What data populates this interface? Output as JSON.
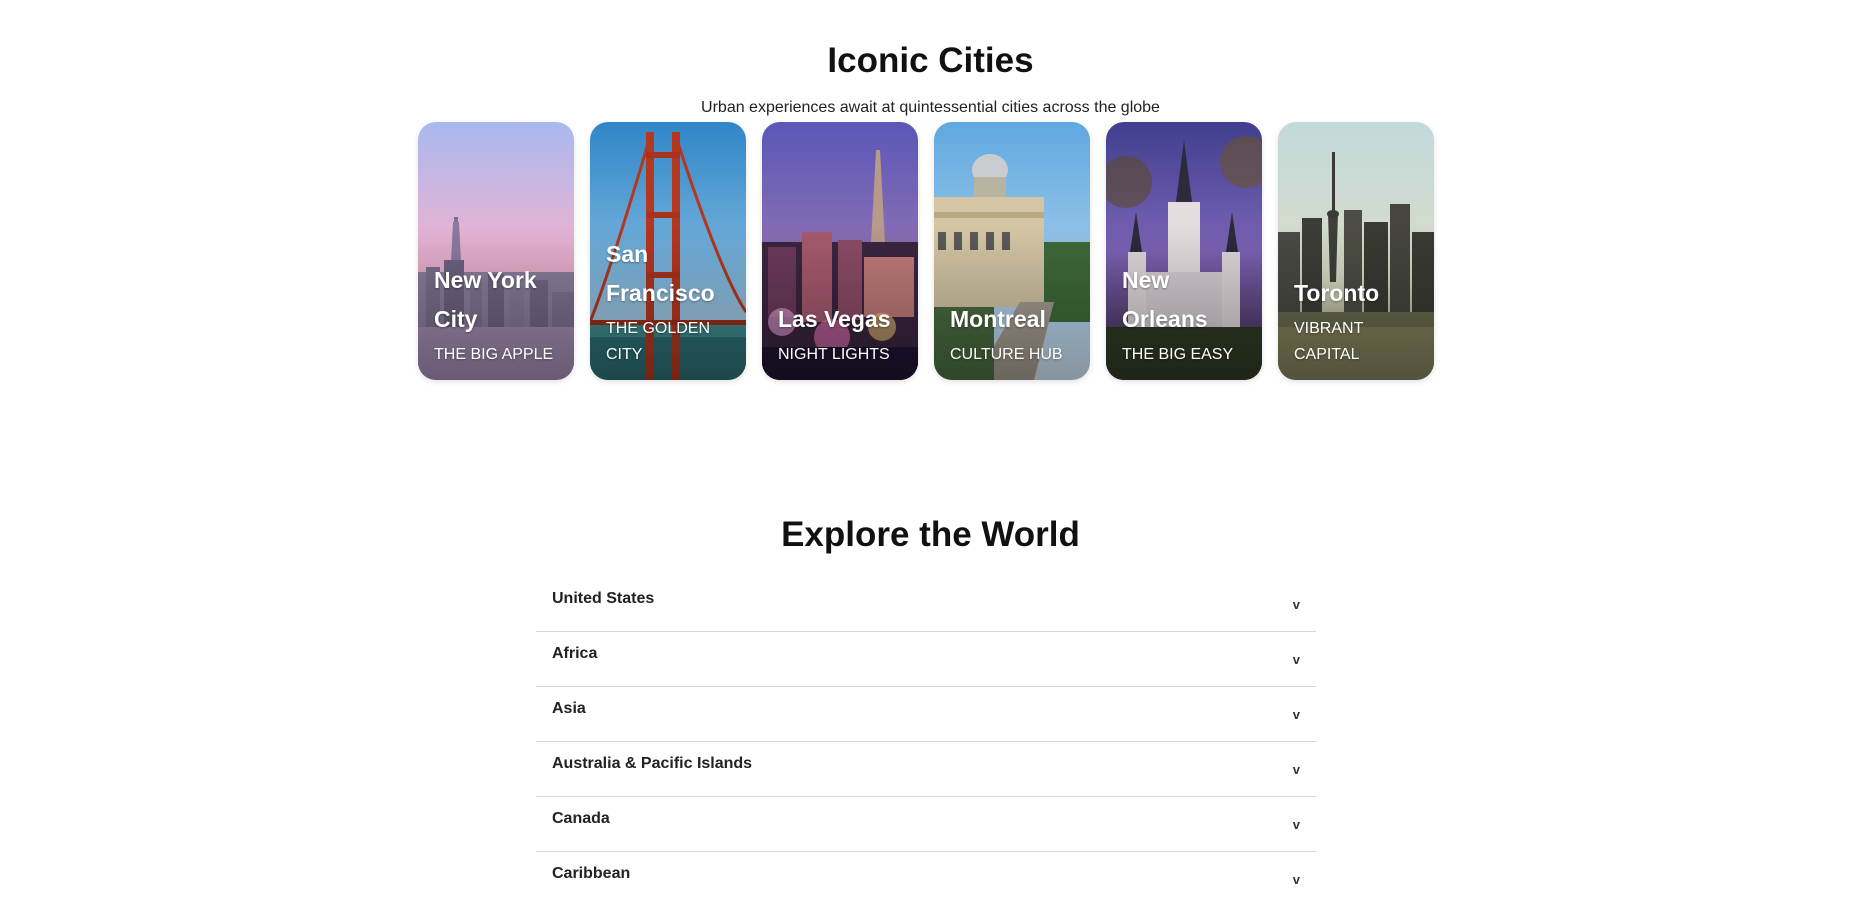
{
  "iconic": {
    "title": "Iconic Cities",
    "subtitle": "Urban experiences await at quintessential cities across the globe",
    "cards": [
      {
        "name": "New York City",
        "tagline": "THE BIG APPLE"
      },
      {
        "name": "San Francisco",
        "tagline": "THE GOLDEN CITY"
      },
      {
        "name": "Las Vegas",
        "tagline": "NIGHT LIGHTS"
      },
      {
        "name": "Montreal",
        "tagline": "CULTURE HUB"
      },
      {
        "name": "New Orleans",
        "tagline": "THE BIG EASY"
      },
      {
        "name": "Toronto",
        "tagline": "VIBRANT CAPITAL"
      }
    ]
  },
  "explore": {
    "title": "Explore the World",
    "chevron": "v",
    "regions": [
      {
        "label": "United States"
      },
      {
        "label": "Africa"
      },
      {
        "label": "Asia"
      },
      {
        "label": "Australia & Pacific Islands"
      },
      {
        "label": "Canada"
      },
      {
        "label": "Caribbean"
      }
    ]
  }
}
